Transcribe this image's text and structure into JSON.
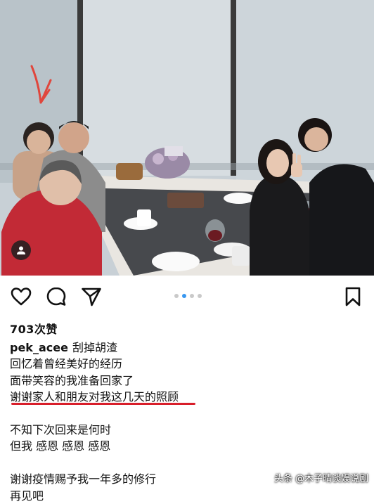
{
  "post": {
    "likes_text": "703次赞",
    "username": "pek_acee",
    "caption_first": "刮掉胡渣",
    "caption_lines": [
      "回忆着曾经美好的经历",
      "面带笑容的我准备回家了",
      "谢谢家人和朋友对我这几天的照顾",
      "",
      "不知下次回来是何时",
      "但我 感恩 感恩 感恩",
      "",
      "谢谢疫情赐予我一年多的修行",
      "再见吧"
    ],
    "carousel": {
      "count": 4,
      "active_index": 1
    }
  },
  "watermark": {
    "source": "头条",
    "author": "@木子晴谈娱说剧"
  },
  "colors": {
    "underline": "#d81e2a",
    "active_dot": "#3897f0",
    "annotation_arrow": "#e0463c"
  },
  "icons": {
    "like": "heart-icon",
    "comment": "comment-icon",
    "share": "send-icon",
    "save": "bookmark-icon",
    "tag": "user-icon"
  }
}
